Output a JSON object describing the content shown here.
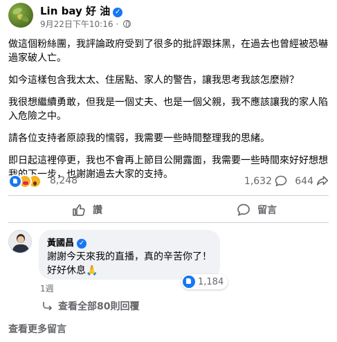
{
  "post": {
    "author": "Lin bay 好 油",
    "verified_icon": "verified-badge-icon",
    "date": "9月22日下午10:16",
    "separator": "·",
    "audience_icon": "globe-icon",
    "paragraphs": [
      "做這個粉絲團，我評論政府受到了很多的批評跟抹黑，在過去也曾經被恐嚇過家破人亡。",
      "如今這樣包含我太太、住居點、家人的警告，讓我思考我該怎麼辦？",
      "我很想繼續勇敢，但我是一個丈夫、也是一個父親，我不應該讓我的家人陷入危險之中。",
      "請各位支持者原諒我的懦弱，我需要一些時間整理我的思緒。",
      "即日起這裡停更，我也不會再上節目公開露面，我需要一些時間來好好想想我的下一步，也謝謝過去大家的支持。"
    ]
  },
  "stats": {
    "reaction_icons": [
      "like-reaction-icon",
      "care-reaction-icon",
      "wow-reaction-icon"
    ],
    "reactions": "8,248",
    "comments": "1,632",
    "shares": "644"
  },
  "actions": {
    "like_label": "讚",
    "comment_label": "留言"
  },
  "comment": {
    "author": "黃國昌",
    "lines": [
      "謝謝今天來我的直播，真的辛苦你了！",
      "好好休息🙏"
    ],
    "likes": "1,184",
    "time": "1週"
  },
  "view_replies": "查看全部80則回覆",
  "more_comments": "查看更多留言",
  "colors": {
    "brand_blue": "#1877f2",
    "secondary_text": "#65676b",
    "bubble_bg": "#f0f2f5"
  }
}
